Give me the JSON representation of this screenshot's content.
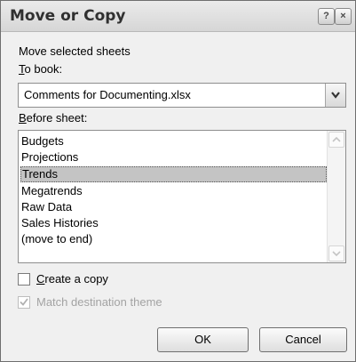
{
  "dialog": {
    "title": "Move or Copy",
    "help_glyph": "?",
    "close_glyph": "×"
  },
  "move": {
    "heading": "Move selected sheets",
    "to_book_mnemonic": "T",
    "to_book_rest": "o book:",
    "to_book_value": "Comments for Documenting.xlsx",
    "before_sheet_mnemonic": "B",
    "before_sheet_rest": "efore sheet:",
    "sheets": [
      "Budgets",
      "Projections",
      "Trends",
      "Megatrends",
      "Raw Data",
      "Sales Histories",
      "(move to end)"
    ],
    "selected_index": 2
  },
  "options": {
    "create_copy_mnemonic": "C",
    "create_copy_rest": "reate a copy",
    "create_copy_checked": false,
    "match_theme_label": "Match destination theme",
    "match_theme_checked": true,
    "match_theme_enabled": false
  },
  "buttons": {
    "ok": "OK",
    "cancel": "Cancel"
  },
  "colors": {
    "dialog_bg": "#f0f0f0",
    "selection_bg": "#c4c4c4",
    "disabled_text": "#a3a3a3"
  },
  "icons": {
    "help": "help-icon",
    "close": "close-icon",
    "dropdown": "chevron-down-icon",
    "scroll_up": "scroll-up-icon",
    "scroll_down": "scroll-down-icon",
    "checkmark": "checkmark-icon"
  }
}
